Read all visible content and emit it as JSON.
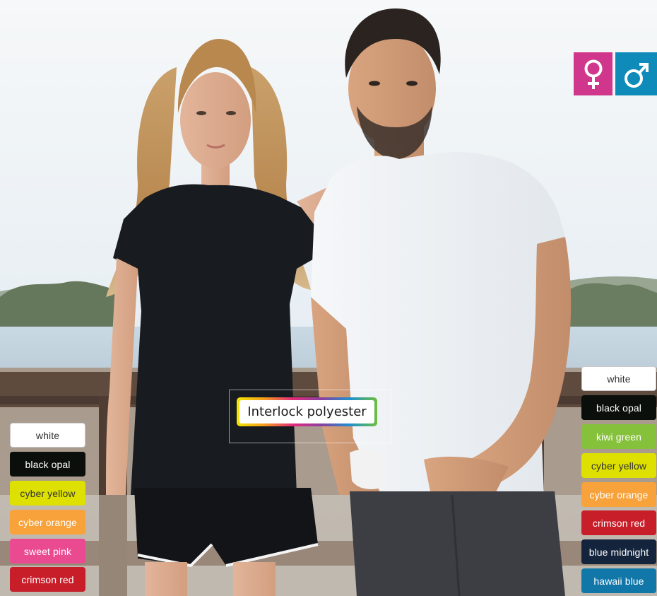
{
  "badges": {
    "female_color": "#d0378c",
    "male_color": "#0e8bb8",
    "female_icon": "female-symbol",
    "male_icon": "male-symbol"
  },
  "material": {
    "label": "Interlock polyester"
  },
  "women_colors": [
    {
      "label": "white",
      "bg": "#ffffff",
      "fg": "#333333"
    },
    {
      "label": "black opal",
      "bg": "#0b0f0c",
      "fg": "#ffffff"
    },
    {
      "label": "cyber yellow",
      "bg": "#dde000",
      "fg": "#333333"
    },
    {
      "label": "cyber orange",
      "bg": "#f7a23b",
      "fg": "#ffffff"
    },
    {
      "label": "sweet pink",
      "bg": "#e94a90",
      "fg": "#ffffff"
    },
    {
      "label": "crimson red",
      "bg": "#c81e2a",
      "fg": "#ffffff"
    }
  ],
  "men_colors": [
    {
      "label": "white",
      "bg": "#ffffff",
      "fg": "#333333"
    },
    {
      "label": "black opal",
      "bg": "#0b0f0c",
      "fg": "#ffffff"
    },
    {
      "label": "kiwi green",
      "bg": "#86c13c",
      "fg": "#ffffff"
    },
    {
      "label": "cyber yellow",
      "bg": "#dde000",
      "fg": "#333333"
    },
    {
      "label": "cyber orange",
      "bg": "#f7a23b",
      "fg": "#ffffff"
    },
    {
      "label": "crimson red",
      "bg": "#c81e2a",
      "fg": "#ffffff"
    },
    {
      "label": "blue midnight",
      "bg": "#14243d",
      "fg": "#ffffff"
    },
    {
      "label": "hawaii blue",
      "bg": "#1177a8",
      "fg": "#ffffff"
    }
  ]
}
